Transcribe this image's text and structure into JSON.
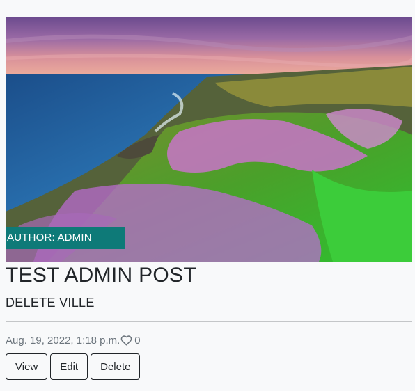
{
  "post": {
    "author_label": "AUTHOR: ADMIN",
    "title": "TEST ADMIN POST",
    "subtitle": "DELETE VILLE",
    "date": "Aug. 19, 2022, 1:18 p.m.",
    "likes": "0"
  },
  "actions": {
    "view_label": "View",
    "edit_label": "Edit",
    "delete_label": "Delete"
  },
  "icons": {
    "like": "heart-outline-icon"
  },
  "colors": {
    "badge": "#0e7a78",
    "background": "#f8f9fa"
  }
}
